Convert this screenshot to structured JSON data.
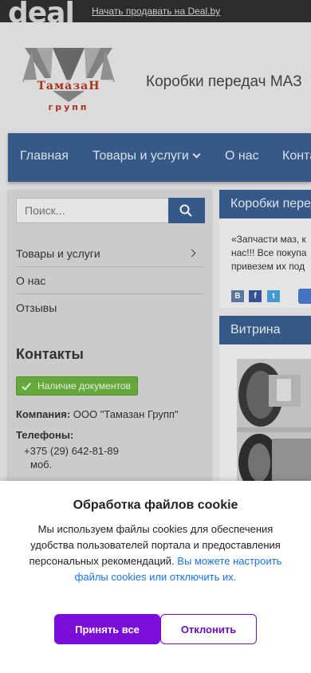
{
  "topbar": {
    "logo_text": "deal",
    "sell_link": "Начать продавать на Deal.by"
  },
  "header": {
    "logo_text": "ТамазаН",
    "logo_subtext": "групп",
    "title": "Коробки передач МАЗ"
  },
  "nav": {
    "items": [
      {
        "label": "Главная"
      },
      {
        "label": "Товары и услуги",
        "has_dropdown": true
      },
      {
        "label": "О нас"
      },
      {
        "label": "Конта"
      }
    ]
  },
  "sidebar": {
    "search_placeholder": "Поиск...",
    "menu": [
      {
        "label": "Товары и услуги",
        "has_arrow": true
      },
      {
        "label": "О нас"
      },
      {
        "label": "Отзывы"
      }
    ],
    "contacts_title": "Контакты",
    "docs_badge": "Наличие документов",
    "company_label": "Компания:",
    "company_value": "ООО \"Тамазан Групп\"",
    "phones_label": "Телефоны:",
    "phone_number": "+375 (29) 642-81-89",
    "phone_type": "моб."
  },
  "main": {
    "section_title": "Коробки перед",
    "text_lines": [
      "«Запчасти маз, к",
      "нас!!! Все покупа",
      "привезем их под"
    ],
    "share_icons": [
      {
        "icon": "vk-icon",
        "glyph": "В",
        "color": "#5d7fa6"
      },
      {
        "icon": "facebook-icon",
        "glyph": "f",
        "color": "#3b5998"
      },
      {
        "icon": "twitter-icon",
        "glyph": "t",
        "color": "#4aa3df"
      }
    ],
    "showcase_title": "Витрина"
  },
  "cookie": {
    "title": "Обработка файлов cookie",
    "text": "Мы используем файлы cookies для обеспечения удобства пользователей портала и предоставления персональных рекомендаций.",
    "link_text": "Вы можете настроить файлы cookies или отключить их.",
    "accept_label": "Принять все",
    "decline_label": "Отклонить"
  },
  "colors": {
    "nav_blue": "#3a5f91",
    "accept_purple": "#7a0ed8",
    "badge_green": "#6db33f",
    "logo_red": "#b5371f"
  }
}
